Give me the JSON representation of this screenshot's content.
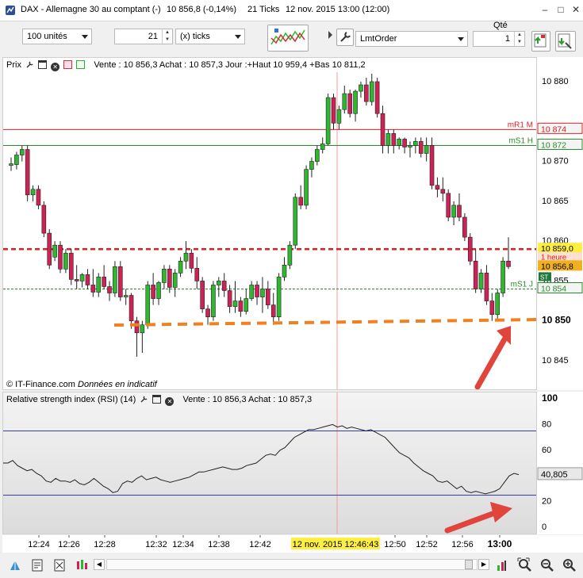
{
  "titlebar": {
    "instrument": "DAX - Allemagne 30 au comptant (-)",
    "price": "10 856,8 (-0,14%)",
    "ticks": "21 Ticks",
    "datetime": "12 nov. 2015 13:00 (12:00)",
    "controls": [
      "–",
      "□",
      "✕"
    ]
  },
  "toolbar": {
    "units_value": "100 unités",
    "tick_count": "21",
    "tick_unit": "(x) ticks",
    "order_type": "LmtOrder",
    "qty_label": "Qté",
    "qty_value": "1"
  },
  "price_panel": {
    "title": "Prix",
    "quote": "Vente : 10 856,3 Achat : 10 857,3 Jour :+Haut 10 959,4 +Bas 10 811,2",
    "watermark": "© IT-Finance.com",
    "watermark_note": "Données en indicatif",
    "levels": [
      {
        "name": "mR1 M",
        "value": "10 874",
        "color": "#e02020"
      },
      {
        "name": "mS1 H",
        "value": "10 872",
        "color": "#2a8a2a"
      },
      {
        "name": "mS1 J",
        "value": "10 854",
        "color": "#2a8a2a"
      }
    ],
    "last_price": "10 856,8",
    "order_price": "10 859,0",
    "order_note": "1 heure",
    "st_badge": "ST",
    "emph_level": "10 850",
    "axis_ticks": [
      "10 880",
      "10 870",
      "10 865",
      "10 860",
      "10 855",
      "10 850",
      "10 845"
    ]
  },
  "rsi_panel": {
    "title": "Relative strength index (RSI) (14)",
    "quote": "Vente : 10 856,3 Achat : 10 857,3",
    "current": "40,805",
    "axis_ticks": [
      "100",
      "80",
      "60",
      "40",
      "20",
      "0"
    ]
  },
  "timeaxis": {
    "labels": [
      "12:24",
      "12:26",
      "12:28",
      "12:32",
      "12:34",
      "12:38",
      "12:42",
      "12:50",
      "12:52",
      "12:56",
      "13:00"
    ],
    "cursor_label": "12 nov. 2015 12:46:43"
  },
  "colors": {
    "bull": "#2fb82f",
    "bear": "#cc2255",
    "order_line": "#e02020",
    "support": "#f08020",
    "arrow": "#e0443a",
    "rsi_band": "#3a3ab0"
  },
  "chart_data": [
    {
      "type": "candlestick",
      "title": "Prix",
      "ylim": [
        10843,
        10883
      ],
      "yticks": [
        10845,
        10850,
        10855,
        10860,
        10865,
        10870,
        10880
      ],
      "xticks": [
        "12:24",
        "12:26",
        "12:28",
        "12:32",
        "12:34",
        "12:38",
        "12:42",
        "12:50",
        "12:52",
        "12:56",
        "13:00"
      ],
      "candles": [
        [
          10869.5,
          10870.5,
          10868.8,
          10869.7
        ],
        [
          10869.6,
          10871.2,
          10869.0,
          10870.8
        ],
        [
          10870.8,
          10872.0,
          10870.0,
          10871.5
        ],
        [
          10871.5,
          10872.0,
          10865.0,
          10865.8
        ],
        [
          10865.8,
          10867.0,
          10865.0,
          10866.5
        ],
        [
          10866.5,
          10867.0,
          10864.0,
          10864.5
        ],
        [
          10864.5,
          10865.0,
          10860.5,
          10861.0
        ],
        [
          10861.0,
          10861.5,
          10856.5,
          10857.0
        ],
        [
          10858.0,
          10860.0,
          10857.5,
          10859.5
        ],
        [
          10859.5,
          10860.0,
          10856.0,
          10856.5
        ],
        [
          10856.5,
          10859.0,
          10856.0,
          10858.5
        ],
        [
          10858.5,
          10859.0,
          10854.5,
          10855.2
        ],
        [
          10855.2,
          10857.0,
          10854.0,
          10855.0
        ],
        [
          10855.0,
          10856.0,
          10854.2,
          10855.8
        ],
        [
          10855.8,
          10856.5,
          10854.0,
          10854.5
        ],
        [
          10854.5,
          10856.5,
          10853.0,
          10853.6
        ],
        [
          10853.6,
          10856.0,
          10853.0,
          10855.5
        ],
        [
          10855.5,
          10857.0,
          10854.0,
          10854.3
        ],
        [
          10854.3,
          10855.0,
          10852.5,
          10853.5
        ],
        [
          10853.5,
          10857.5,
          10853.0,
          10856.8
        ],
        [
          10856.8,
          10857.5,
          10852.5,
          10853.0
        ],
        [
          10853.0,
          10854.0,
          10852.0,
          10853.2
        ],
        [
          10853.2,
          10853.5,
          10849.0,
          10850.0
        ],
        [
          10850.0,
          10850.5,
          10845.5,
          10848.5
        ],
        [
          10848.5,
          10850.0,
          10846.0,
          10849.5
        ],
        [
          10849.5,
          10855.0,
          10849.0,
          10854.5
        ],
        [
          10854.5,
          10856.0,
          10852.0,
          10852.8
        ],
        [
          10852.8,
          10855.0,
          10852.0,
          10854.8
        ],
        [
          10854.8,
          10857.0,
          10854.0,
          10856.5
        ],
        [
          10856.5,
          10857.0,
          10853.5,
          10854.2
        ],
        [
          10854.2,
          10856.5,
          10853.0,
          10856.0
        ],
        [
          10856.0,
          10858.0,
          10855.5,
          10857.5
        ],
        [
          10857.5,
          10860.0,
          10856.5,
          10858.5
        ],
        [
          10858.5,
          10859.0,
          10856.0,
          10856.6
        ],
        [
          10856.6,
          10858.0,
          10854.0,
          10855.0
        ],
        [
          10855.0,
          10855.5,
          10851.0,
          10851.5
        ],
        [
          10851.5,
          10852.0,
          10849.5,
          10850.5
        ],
        [
          10850.5,
          10855.0,
          10850.0,
          10854.5
        ],
        [
          10854.5,
          10855.5,
          10853.0,
          10855.0
        ],
        [
          10855.0,
          10856.0,
          10853.0,
          10853.8
        ],
        [
          10853.8,
          10854.5,
          10851.0,
          10851.8
        ],
        [
          10851.8,
          10855.0,
          10851.0,
          10852.5
        ],
        [
          10852.5,
          10853.0,
          10850.5,
          10851.2
        ],
        [
          10851.2,
          10854.0,
          10850.8,
          10852.8
        ],
        [
          10852.8,
          10855.0,
          10852.5,
          10854.5
        ],
        [
          10854.5,
          10855.0,
          10852.0,
          10853.0
        ],
        [
          10853.0,
          10855.5,
          10851.0,
          10854.0
        ],
        [
          10854.0,
          10855.0,
          10851.5,
          10852.0
        ],
        [
          10852.0,
          10853.5,
          10849.5,
          10850.5
        ],
        [
          10850.5,
          10856.0,
          10850.0,
          10855.5
        ],
        [
          10855.5,
          10858.0,
          10855.0,
          10857.0
        ],
        [
          10857.0,
          10860.0,
          10856.5,
          10859.5
        ],
        [
          10859.5,
          10866.0,
          10859.0,
          10865.5
        ],
        [
          10865.5,
          10867.0,
          10864.0,
          10864.5
        ],
        [
          10864.5,
          10869.5,
          10864.0,
          10869.0
        ],
        [
          10869.0,
          10870.5,
          10868.0,
          10870.0
        ],
        [
          10870.0,
          10872.0,
          10869.5,
          10871.5
        ],
        [
          10871.5,
          10873.0,
          10871.0,
          10872.2
        ],
        [
          10872.2,
          10878.5,
          10872.0,
          10878.0
        ],
        [
          10878.0,
          10878.5,
          10874.0,
          10874.8
        ],
        [
          10874.8,
          10877.0,
          10874.0,
          10876.5
        ],
        [
          10876.5,
          10879.5,
          10876.0,
          10878.5
        ],
        [
          10878.5,
          10879.0,
          10875.5,
          10876.0
        ],
        [
          10876.0,
          10879.0,
          10875.0,
          10878.8
        ],
        [
          10878.8,
          10880.0,
          10878.0,
          10879.6
        ],
        [
          10879.6,
          10880.5,
          10877.0,
          10877.5
        ],
        [
          10877.5,
          10881.0,
          10877.0,
          10880.0
        ],
        [
          10880.0,
          10880.5,
          10875.5,
          10876.0
        ],
        [
          10876.0,
          10877.0,
          10871.0,
          10872.0
        ],
        [
          10872.0,
          10874.0,
          10871.0,
          10873.5
        ],
        [
          10873.5,
          10874.0,
          10871.0,
          10872.0
        ],
        [
          10872.0,
          10873.0,
          10871.5,
          10872.8
        ],
        [
          10872.8,
          10873.0,
          10871.0,
          10871.8
        ],
        [
          10871.8,
          10872.5,
          10870.5,
          10872.0
        ],
        [
          10872.0,
          10873.0,
          10871.0,
          10872.5
        ],
        [
          10872.5,
          10873.0,
          10870.5,
          10871.0
        ],
        [
          10871.0,
          10873.0,
          10870.0,
          10872.0
        ],
        [
          10872.0,
          10873.0,
          10866.5,
          10867.0
        ],
        [
          10867.0,
          10868.0,
          10865.5,
          10866.5
        ],
        [
          10866.5,
          10868.0,
          10865.0,
          10866.0
        ],
        [
          10866.0,
          10866.5,
          10862.5,
          10863.0
        ],
        [
          10863.0,
          10865.0,
          10862.0,
          10864.5
        ],
        [
          10864.5,
          10866.0,
          10862.5,
          10863.0
        ],
        [
          10863.0,
          10863.5,
          10860.0,
          10860.5
        ],
        [
          10860.5,
          10861.0,
          10857.0,
          10857.5
        ],
        [
          10857.5,
          10859.0,
          10853.5,
          10854.0
        ],
        [
          10854.0,
          10856.5,
          10853.5,
          10856.0
        ],
        [
          10856.0,
          10857.0,
          10852.0,
          10852.5
        ],
        [
          10852.5,
          10853.5,
          10850.0,
          10850.8
        ],
        [
          10850.8,
          10854.0,
          10850.0,
          10853.5
        ],
        [
          10853.5,
          10858.0,
          10853.0,
          10857.5
        ],
        [
          10857.5,
          10860.5,
          10856.5,
          10856.8
        ]
      ]
    },
    {
      "type": "line",
      "title": "Relative strength index (RSI) (14)",
      "ylim": [
        0,
        100
      ],
      "yticks": [
        0,
        20,
        40,
        60,
        80,
        100
      ],
      "bands": [
        75,
        25
      ],
      "series": [
        {
          "values": [
            50,
            50,
            52,
            48,
            46,
            44,
            45,
            42,
            40,
            36,
            35,
            38,
            36,
            36,
            35,
            37,
            34,
            33,
            35,
            38,
            35,
            32,
            30,
            27,
            28,
            34,
            36,
            35,
            38,
            40,
            37,
            38,
            39,
            37,
            36,
            35,
            36,
            37,
            38,
            39,
            41,
            43,
            43,
            44,
            45,
            46,
            47,
            46,
            45,
            45,
            46,
            48,
            49,
            50,
            53,
            56,
            57,
            56,
            60,
            62,
            66,
            70,
            72,
            74,
            76,
            76,
            77,
            78,
            79,
            80,
            78,
            79,
            77,
            78,
            77,
            76,
            75,
            76,
            74,
            72,
            70,
            66,
            62,
            58,
            56,
            54,
            50,
            47,
            44,
            42,
            40,
            36,
            35,
            36,
            33,
            30,
            32,
            28,
            27,
            28,
            27,
            26,
            27,
            28,
            30,
            35,
            40,
            42,
            41
          ]
        }
      ]
    }
  ]
}
